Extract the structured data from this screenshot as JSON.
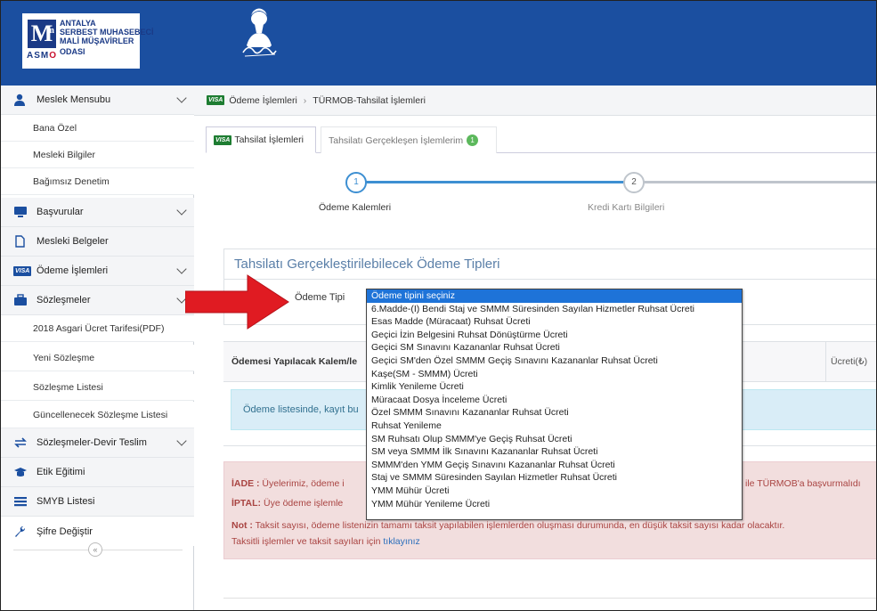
{
  "header": {
    "logo_m": "M",
    "logo_sup": "m",
    "logo_asmo": "ASMO",
    "logo_line1": "ANTALYA",
    "logo_line2": "SERBEST MUHASEBECİ",
    "logo_line3": "MALİ MÜŞAVİRLER",
    "logo_line4": "ODASI",
    "bg_color": "#1b4fa0"
  },
  "sidebar": {
    "items": [
      {
        "label": "Meslek Mensubu",
        "icon": "user-icon",
        "has_chevron": true
      },
      {
        "label": "Bana Özel",
        "sub": true
      },
      {
        "label": "Mesleki Bilgiler",
        "sub": true
      },
      {
        "label": "Bağımsız Denetim",
        "sub": true
      },
      {
        "label": "Başvurular",
        "icon": "monitor-icon",
        "has_chevron": true
      },
      {
        "label": "Mesleki Belgeler",
        "icon": "document-icon",
        "has_chevron": false
      },
      {
        "label": "Ödeme İşlemleri",
        "icon": "visa-icon",
        "has_chevron": true
      },
      {
        "label": "Sözleşmeler",
        "icon": "briefcase-icon",
        "has_chevron": true
      },
      {
        "label": "2018 Asgari Ücret Tarifesi(PDF)",
        "sub": true
      },
      {
        "label": "Yeni Sözleşme",
        "sub": true
      },
      {
        "label": "Sözleşme Listesi",
        "sub": true
      },
      {
        "label": "Güncellenecek Sözleşme Listesi",
        "sub": true
      },
      {
        "label": "Sözleşmeler-Devir Teslim",
        "icon": "transfer-icon",
        "has_chevron": true
      },
      {
        "label": "Etik Eğitimi",
        "icon": "graduation-cap-icon",
        "has_chevron": false
      },
      {
        "label": "SMYB Listesi",
        "icon": "list-icon",
        "has_chevron": false
      },
      {
        "label": "Şifre Değiştir",
        "icon": "wrench-icon",
        "has_chevron": false
      }
    ],
    "collapse_glyph": "«"
  },
  "breadcrumb": {
    "visa": "VISA",
    "item1": "Ödeme İşlemleri",
    "sep": "›",
    "item2": "TÜRMOB-Tahsilat İşlemleri"
  },
  "tabs": {
    "tab1": "Tahsilat İşlemleri",
    "tab2": "Tahsilatı Gerçekleşen İşlemlerim",
    "tab2_badge": "1"
  },
  "steps": {
    "step1_num": "1",
    "step1_label": "Ödeme Kalemleri",
    "step2_num": "2",
    "step2_label": "Kredi Kartı Bilgileri"
  },
  "panel": {
    "title": "Tahsilatı Gerçekleştirilebilecek Ödeme Tipleri",
    "field_label": "Ödeme Tipi"
  },
  "table": {
    "col_left": "Ödemesi Yapılacak Kalem/le",
    "col_right": "Ücreti(₺)"
  },
  "info": {
    "text": "Ödeme listesinde, kayıt bu"
  },
  "notices": {
    "iade_label": "İADE :",
    "iade_text": " Üyelerimiz, ödeme i",
    "iade_tail": "ile TÜRMOB'a başvurmalıdı",
    "iptal_label": "İPTAL:",
    "iptal_text": " Üye ödeme işlemle",
    "not_label": "Not :",
    "not_text": " Taksit sayısı, ödeme listenizin tamamı taksit yapılabilen işlemlerden oluşması durumunda, en düşük taksit sayısı kadar olacaktır.",
    "taksit_text": "Taksitli işlemler ve taksit sayıları için ",
    "taksit_link": "tıklayınız"
  },
  "dropdown": {
    "selected": "Ödeme tipini seçiniz",
    "options": [
      "Ödeme tipini seçiniz",
      "6.Madde-(I) Bendi Staj ve SMMM Süresinden Sayılan Hizmetler Ruhsat Ücreti",
      "Esas Madde (Müracaat) Ruhsat Ücreti",
      "Geçici İzin Belgesini Ruhsat Dönüştürme Ücreti",
      "Geçici SM Sınavını Kazananlar Ruhsat Ücreti",
      "Geçici SM'den Özel SMMM Geçiş Sınavını Kazananlar Ruhsat Ücreti",
      "Kaşe(SM - SMMM) Ücreti",
      "Kimlik Yenileme Ücreti",
      "Müracaat Dosya İnceleme Ücreti",
      "Özel SMMM Sınavını Kazananlar Ruhsat Ücreti",
      "Ruhsat Yenileme",
      "SM Ruhsatı Olup SMMM'ye Geçiş Ruhsat Ücreti",
      "SM veya SMMM İlk Sınavını Kazananlar Ruhsat Ücreti",
      "SMMM'den YMM Geçiş Sınavını Kazananlar Ruhsat Ücreti",
      "Staj ve SMMM Süresinden Sayılan Hizmetler Ruhsat Ücreti",
      "YMM Mühür Ücreti",
      "YMM Mühür Yenileme Ücreti"
    ]
  },
  "colors": {
    "accent": "#3d8fd2",
    "arrow": "#e01b22",
    "danger_text": "#a94442",
    "info_bg": "#d9edf7"
  }
}
